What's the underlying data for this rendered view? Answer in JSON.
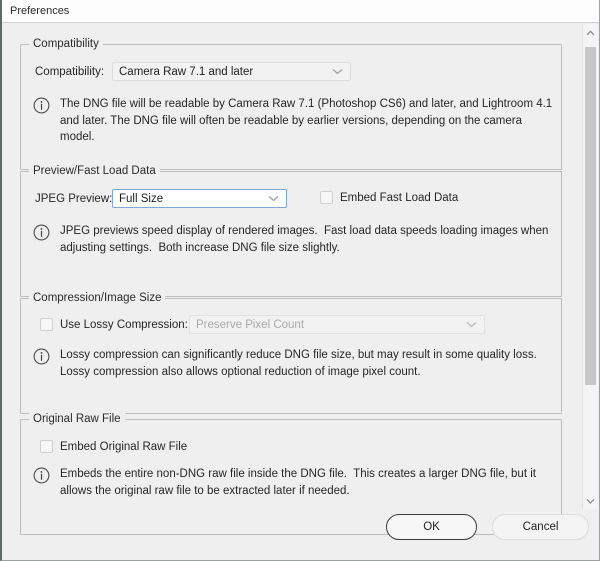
{
  "window": {
    "title": "Preferences"
  },
  "scrollbar": {
    "up_arrow_icon": "chevron-up-icon",
    "down_arrow_icon": "chevron-down-icon"
  },
  "sections": {
    "compatibility": {
      "legend": "Compatibility",
      "field_label": "Compatibility:",
      "dropdown_value": "Camera Raw 7.1 and later",
      "note": "The DNG file will be readable by Camera Raw 7.1 (Photoshop CS6) and later, and Lightroom 4.1\nand later. The DNG file will often be readable by earlier versions, depending on the camera\nmodel."
    },
    "preview": {
      "legend": "Preview/Fast Load Data",
      "field_label": "JPEG Preview:",
      "dropdown_value": "Full Size",
      "checkbox_label": "Embed Fast Load Data",
      "checkbox_checked": "false",
      "note": "JPEG previews speed display of rendered images.  Fast load data speeds loading images when\nadjusting settings.  Both increase DNG file size slightly."
    },
    "compression": {
      "legend": "Compression/Image Size",
      "checkbox_label": "Use Lossy Compression:",
      "checkbox_checked": "false",
      "dropdown_value": "Preserve Pixel Count",
      "note": "Lossy compression can significantly reduce DNG file size, but may result in some quality loss.\nLossy compression also allows optional reduction of image pixel count."
    },
    "original_raw": {
      "legend": "Original Raw File",
      "checkbox_label": "Embed Original Raw File",
      "checkbox_checked": "false",
      "note": "Embeds the entire non-DNG raw file inside the DNG file.  This creates a larger DNG file, but it\nallows the original raw file to be extracted later if needed."
    }
  },
  "footer": {
    "ok_label": "OK",
    "cancel_label": "Cancel"
  },
  "colors": {
    "background": "#efefef",
    "focus_border": "#7ca7d6",
    "group_border": "#bdbdbd",
    "text": "#262626",
    "disabled_text": "#aaaaaa",
    "scrollbar_thumb": "#c6c6c6"
  }
}
